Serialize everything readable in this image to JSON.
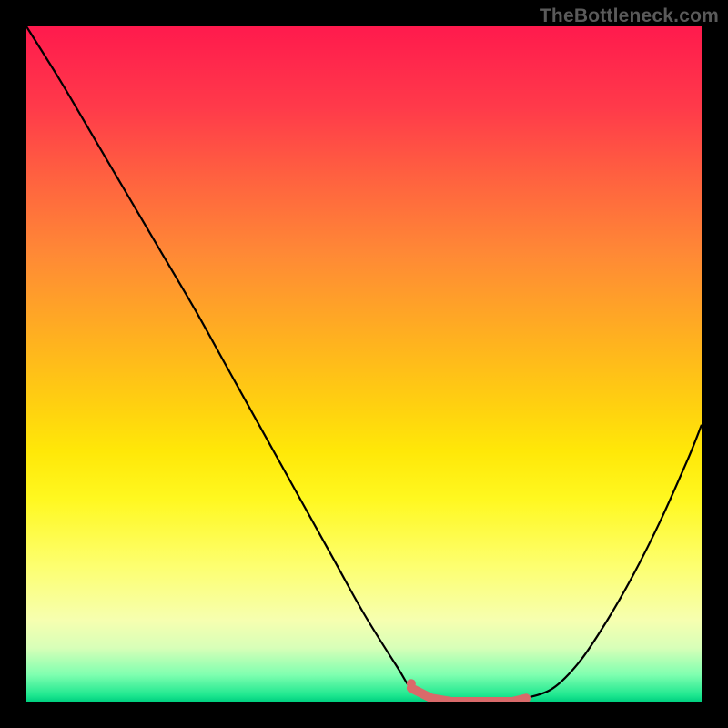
{
  "watermark": "TheBottleneck.com",
  "chart_data": {
    "type": "line",
    "title": "",
    "xlabel": "",
    "ylabel": "",
    "xlim": [
      0,
      100
    ],
    "ylim": [
      0,
      100
    ],
    "series": [
      {
        "name": "bottleneck-curve",
        "x": [
          0,
          5,
          10,
          15,
          20,
          25,
          30,
          35,
          40,
          45,
          50,
          55,
          57,
          60,
          63,
          65,
          69,
          72,
          74,
          78,
          82,
          86,
          90,
          94,
          98,
          100
        ],
        "values": [
          100,
          92,
          83.5,
          75,
          66.5,
          58,
          49,
          40,
          31,
          22,
          13,
          5,
          2,
          0.5,
          0,
          0,
          0,
          0,
          0.5,
          2,
          6,
          12,
          19,
          27,
          36,
          41
        ]
      }
    ],
    "markers": {
      "name": "highlight-segment",
      "x": [
        57,
        60,
        63,
        65,
        69,
        72,
        74
      ],
      "values": [
        2,
        0.5,
        0,
        0,
        0,
        0,
        0.5
      ],
      "color": "#d96a6a"
    },
    "gradient_stops": [
      {
        "pos": 0,
        "color": "#ff1a4d"
      },
      {
        "pos": 22,
        "color": "#ff6040"
      },
      {
        "pos": 46,
        "color": "#ffb020"
      },
      {
        "pos": 70,
        "color": "#fff820"
      },
      {
        "pos": 92,
        "color": "#d8ffb8"
      },
      {
        "pos": 100,
        "color": "#00d080"
      }
    ]
  }
}
